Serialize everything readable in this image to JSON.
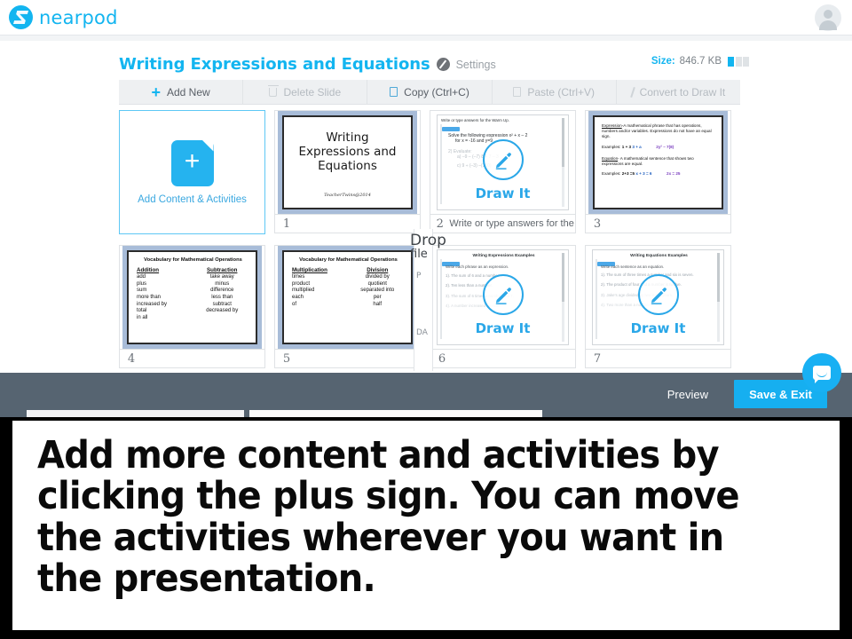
{
  "app": {
    "brand": "nearpod",
    "brand_color": "#13b5f0",
    "avatar_icon": "user-avatar-icon"
  },
  "editor": {
    "deck_title": "Writing Expressions and Equations",
    "settings_label": "Settings",
    "size_key": "Size:",
    "size_value": "846.7 KB",
    "size_bars_filled": 1,
    "size_bars_total": 3
  },
  "toolbar": {
    "items": [
      {
        "label": "Add New",
        "icon": "plus-icon",
        "enabled": true
      },
      {
        "label": "Delete Slide",
        "icon": "trash-icon",
        "enabled": false
      },
      {
        "label": "Copy (Ctrl+C)",
        "icon": "copy-icon",
        "enabled": true
      },
      {
        "label": "Paste (Ctrl+V)",
        "icon": "paste-icon",
        "enabled": false
      },
      {
        "label": "Convert to Draw It",
        "icon": "pencil-slash-icon",
        "enabled": false
      }
    ]
  },
  "add_tile": {
    "label": "Add Content & Activities",
    "icon": "add-document-plus-icon"
  },
  "slides": [
    {
      "number": "1",
      "caption": "",
      "type": "title",
      "title_lines": [
        "Writing",
        "Expressions and",
        "Equations"
      ],
      "signature": "TeacherTwins@2014"
    },
    {
      "number": "2",
      "caption": "Write or type answers for the War...",
      "type": "drawit",
      "drawit_label": "Draw It",
      "doc_header": "Write or type answers for the Warm Up.",
      "doc_lines": [
        "Solve the following expression x² + x – 2",
        "for x = -16 and y=9",
        "2)  Evaluate:",
        "a)  –9 – (–7)            8 + 7 – 3",
        "c)  9 ÷ (–3)            –(100)"
      ]
    },
    {
      "number": "3",
      "caption": "",
      "type": "definitions",
      "def1_term": "Expression",
      "def1_text": "-A mathematical phrase that has operations, numbers and/or variables. Expressions do not have an equal sign.",
      "def1_examples_label": "Examples:",
      "def1_ex_a": "1 + 3",
      "def1_ex_b": "3 + a",
      "def1_ex_c": "2y² – 7(8)",
      "def2_term": "Equation",
      "def2_text": "- A mathematical sentence that shows two expressions are equal.",
      "def2_examples_label": "Examples:",
      "def2_ex_a": "2+3 =5",
      "def2_ex_b": "x + 3 = 6",
      "def2_ex_c": "2x = 25"
    },
    {
      "number": "4",
      "caption": "",
      "type": "vocab",
      "heading": "Vocabulary for Mathematical Operations",
      "col_left_head": "Addition",
      "col_left_items": [
        "add",
        "plus",
        "sum",
        "more than",
        "increased by",
        "total",
        "in all"
      ],
      "col_right_head": "Subtraction",
      "col_right_items": [
        "take away",
        "minus",
        "difference",
        "less than",
        "subtract",
        "decreased by"
      ]
    },
    {
      "number": "5",
      "caption": "",
      "type": "vocab",
      "heading": "Vocabulary for Mathematical Operations",
      "col_left_head": "Multiplication",
      "col_left_items": [
        "times",
        "product",
        "multiplied",
        "each",
        "of"
      ],
      "col_right_head": "Division",
      "col_right_items": [
        "divided by",
        "quotient",
        "separated into",
        "per",
        "half"
      ]
    },
    {
      "number": "6",
      "caption": "",
      "type": "drawit",
      "drawit_label": "Draw It",
      "doc_header": "Writing Expressions Examples",
      "doc_lines": [
        "Write each phrase as an expression.",
        "1).  The sum of 6 and a number.",
        "2).  Ten less than a number.",
        "3).  The sum of 6 times a number and 7.",
        "4).  A number increased by nine."
      ]
    },
    {
      "number": "7",
      "caption": "",
      "type": "drawit",
      "drawit_label": "Draw It",
      "doc_header": "Writing Equations Examples",
      "doc_lines": [
        "Write each sentence as an equation.",
        "1).  The sum of three times a number and six is seven.",
        "2).  The product of four and a number is twelve.",
        "3).  Jake's age divided by two is ten years.",
        "4).  Two more than a number is ten."
      ]
    }
  ],
  "overlay_fragment": {
    "line1": "Drop",
    "line2": "file",
    "ghost_labels": [
      "P",
      "DA"
    ]
  },
  "action_bar": {
    "preview_label": "Preview",
    "save_label": "Save & Exit",
    "save_color": "#16aff0",
    "bar_color": "#566471",
    "chat_icon": "chat-bubble-icon"
  },
  "caption": {
    "text": "Add more content and activities by clicking the plus sign. You can move the activities wherever you want in the presentation."
  }
}
